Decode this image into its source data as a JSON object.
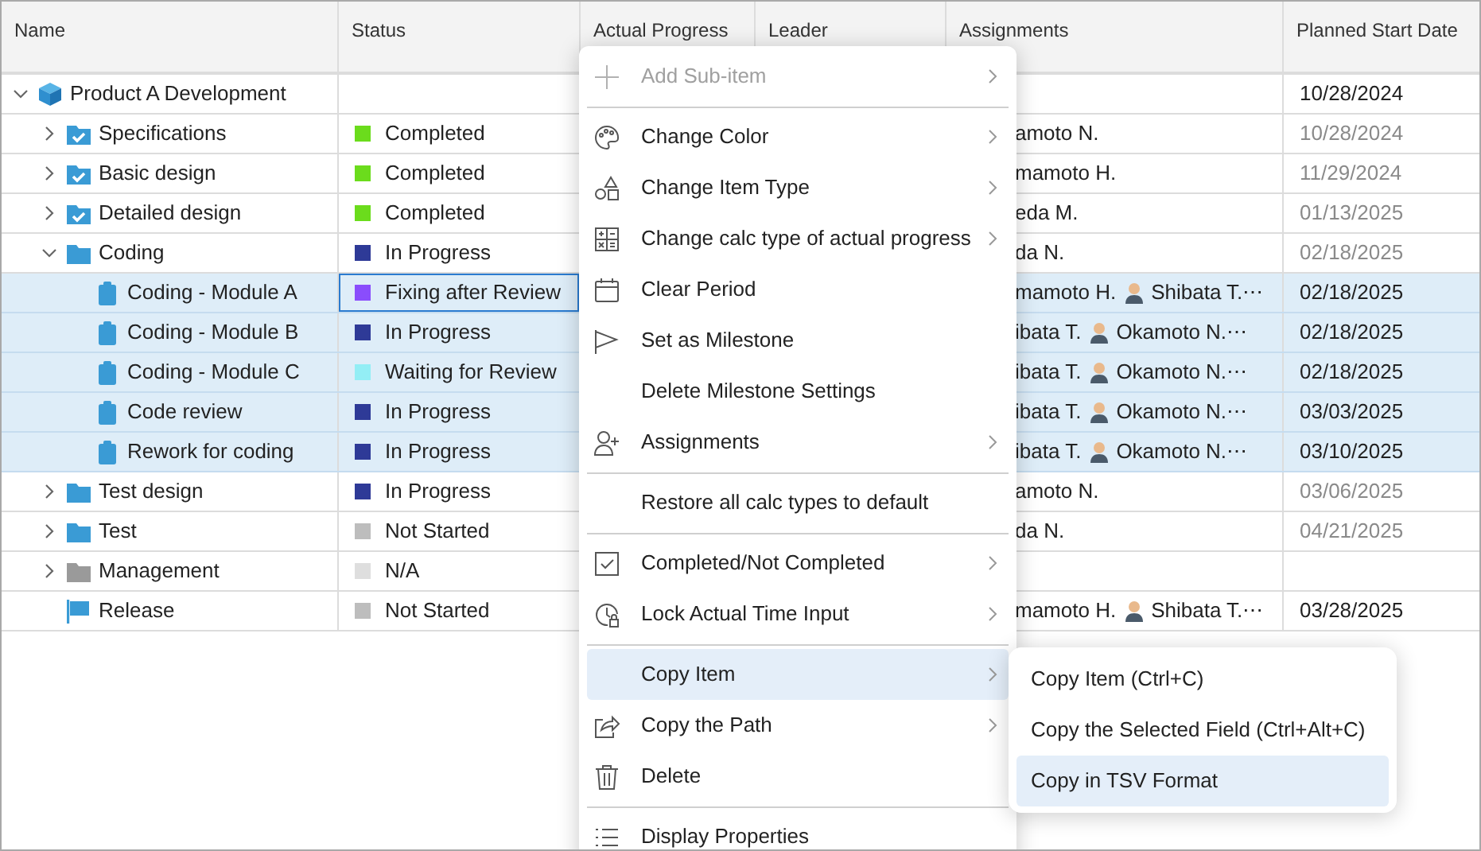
{
  "table": {
    "columns": [
      {
        "label": "Name"
      },
      {
        "label": "Status"
      },
      {
        "label": "Actual Progress"
      },
      {
        "label": "Leader"
      },
      {
        "label": "Assignments"
      },
      {
        "label": "Planned Start Date"
      }
    ],
    "rows": [
      {
        "kind": "project",
        "name": "Product A Development",
        "expanded": true,
        "selected": false,
        "planned_start": "10/28/2024",
        "date_dimmed": false,
        "children": [
          {
            "kind": "done-folder",
            "name": "Specifications",
            "expanded": false,
            "selected": false,
            "status": {
              "label": "Completed",
              "color": "#6bdc1c",
              "focused": false
            },
            "assignments": [
              {
                "name": "amoto N.",
                "avatar": false
              }
            ],
            "planned_start": "10/28/2024",
            "date_dimmed": true
          },
          {
            "kind": "done-folder",
            "name": "Basic design",
            "expanded": false,
            "selected": false,
            "status": {
              "label": "Completed",
              "color": "#6bdc1c",
              "focused": false
            },
            "assignments": [
              {
                "name": "mamoto H.",
                "avatar": false
              }
            ],
            "planned_start": "11/29/2024",
            "date_dimmed": true
          },
          {
            "kind": "done-folder",
            "name": "Detailed design",
            "expanded": false,
            "selected": false,
            "status": {
              "label": "Completed",
              "color": "#6bdc1c",
              "focused": false
            },
            "assignments": [
              {
                "name": "eda M.",
                "avatar": false
              }
            ],
            "planned_start": "01/13/2025",
            "date_dimmed": true
          },
          {
            "kind": "folder",
            "name": "Coding",
            "expanded": true,
            "selected": false,
            "status": {
              "label": "In Progress",
              "color": "#2e3a97",
              "focused": false
            },
            "assignments": [
              {
                "name": "da N.",
                "avatar": false
              }
            ],
            "planned_start": "02/18/2025",
            "date_dimmed": true,
            "children": [
              {
                "kind": "task",
                "name": "Coding - Module A",
                "selected": true,
                "status": {
                  "label": "Fixing after Review",
                  "color": "#8a4dfc",
                  "focused": true
                },
                "assignments": [
                  {
                    "name": "mamoto H.",
                    "avatar": false
                  },
                  {
                    "name": "Shibata T.⋯",
                    "avatar": true
                  }
                ],
                "planned_start": "02/18/2025",
                "date_dimmed": false
              },
              {
                "kind": "task",
                "name": "Coding - Module B",
                "selected": true,
                "status": {
                  "label": "In Progress",
                  "color": "#2e3a97",
                  "focused": false
                },
                "assignments": [
                  {
                    "name": "ibata T.",
                    "avatar": false
                  },
                  {
                    "name": "Okamoto N.⋯",
                    "avatar": true
                  }
                ],
                "planned_start": "02/18/2025",
                "date_dimmed": false
              },
              {
                "kind": "task",
                "name": "Coding - Module C",
                "selected": true,
                "status": {
                  "label": "Waiting for Review",
                  "color": "#93eef5",
                  "focused": false
                },
                "assignments": [
                  {
                    "name": "ibata T.",
                    "avatar": false
                  },
                  {
                    "name": "Okamoto N.⋯",
                    "avatar": true
                  }
                ],
                "planned_start": "02/18/2025",
                "date_dimmed": false
              },
              {
                "kind": "task",
                "name": "Code review",
                "selected": true,
                "status": {
                  "label": "In Progress",
                  "color": "#2e3a97",
                  "focused": false
                },
                "assignments": [
                  {
                    "name": "ibata T.",
                    "avatar": false
                  },
                  {
                    "name": "Okamoto N.⋯",
                    "avatar": true
                  }
                ],
                "planned_start": "03/03/2025",
                "date_dimmed": false
              },
              {
                "kind": "task",
                "name": "Rework for coding",
                "selected": true,
                "status": {
                  "label": "In Progress",
                  "color": "#2e3a97",
                  "focused": false
                },
                "assignments": [
                  {
                    "name": "ibata T.",
                    "avatar": false
                  },
                  {
                    "name": "Okamoto N.⋯",
                    "avatar": true
                  }
                ],
                "planned_start": "03/10/2025",
                "date_dimmed": false
              }
            ]
          },
          {
            "kind": "folder",
            "name": "Test design",
            "expanded": false,
            "selected": false,
            "status": {
              "label": "In Progress",
              "color": "#2e3a97",
              "focused": false
            },
            "assignments": [
              {
                "name": "amoto N.",
                "avatar": false
              }
            ],
            "planned_start": "03/06/2025",
            "date_dimmed": true
          },
          {
            "kind": "folder",
            "name": "Test",
            "expanded": false,
            "selected": false,
            "status": {
              "label": "Not Started",
              "color": "#bdbdbd",
              "focused": false
            },
            "assignments": [
              {
                "name": "da N.",
                "avatar": false
              }
            ],
            "planned_start": "04/21/2025",
            "date_dimmed": true
          },
          {
            "kind": "inactive-folder",
            "name": "Management",
            "expanded": false,
            "selected": false,
            "status": {
              "label": "N/A",
              "color": "#dedede",
              "focused": false
            }
          },
          {
            "kind": "milestone",
            "name": "Release",
            "selected": false,
            "status": {
              "label": "Not Started",
              "color": "#bdbdbd",
              "focused": false
            },
            "assignments": [
              {
                "name": "mamoto H.",
                "avatar": false
              },
              {
                "name": "Shibata T.⋯",
                "avatar": true
              }
            ],
            "planned_start": "03/28/2025",
            "date_dimmed": false
          }
        ]
      }
    ]
  },
  "context_menu": {
    "items": [
      {
        "kind": "item",
        "label": "Add Sub-item",
        "submenu": true,
        "disabled": true,
        "selected": false
      },
      {
        "kind": "separator"
      },
      {
        "kind": "item",
        "label": "Change Color",
        "submenu": true,
        "disabled": false,
        "selected": false
      },
      {
        "kind": "item",
        "label": "Change Item Type",
        "submenu": true,
        "disabled": false,
        "selected": false
      },
      {
        "kind": "item",
        "label": "Change calc type of actual progress",
        "submenu": true,
        "disabled": false,
        "selected": false
      },
      {
        "kind": "item",
        "label": "Clear Period",
        "submenu": false,
        "disabled": false,
        "selected": false
      },
      {
        "kind": "item",
        "label": "Set as Milestone",
        "submenu": false,
        "disabled": false,
        "selected": false
      },
      {
        "kind": "item",
        "label": "Delete Milestone Settings",
        "submenu": false,
        "disabled": false,
        "selected": false
      },
      {
        "kind": "item",
        "label": "Assignments",
        "submenu": true,
        "disabled": false,
        "selected": false
      },
      {
        "kind": "separator"
      },
      {
        "kind": "item",
        "label": "Restore all calc types to default",
        "submenu": false,
        "disabled": false,
        "selected": false
      },
      {
        "kind": "separator"
      },
      {
        "kind": "item",
        "label": "Completed/Not Completed",
        "submenu": true,
        "disabled": false,
        "selected": false
      },
      {
        "kind": "item",
        "label": "Lock Actual Time Input",
        "submenu": true,
        "disabled": false,
        "selected": false
      },
      {
        "kind": "separator"
      },
      {
        "kind": "item",
        "label": "Copy Item",
        "submenu": true,
        "disabled": false,
        "selected": true
      },
      {
        "kind": "item",
        "label": "Copy the Path",
        "submenu": true,
        "disabled": false,
        "selected": false
      },
      {
        "kind": "item",
        "label": "Delete",
        "submenu": false,
        "disabled": false,
        "selected": false
      },
      {
        "kind": "separator"
      },
      {
        "kind": "item",
        "label": "Display Properties",
        "submenu": false,
        "disabled": false,
        "selected": false
      }
    ]
  },
  "submenu": {
    "items": [
      {
        "label": "Copy Item (Ctrl+C)",
        "selected": false
      },
      {
        "label": "Copy the Selected Field (Ctrl+Alt+C)",
        "selected": false
      },
      {
        "label": "Copy in TSV Format",
        "selected": true
      }
    ]
  }
}
